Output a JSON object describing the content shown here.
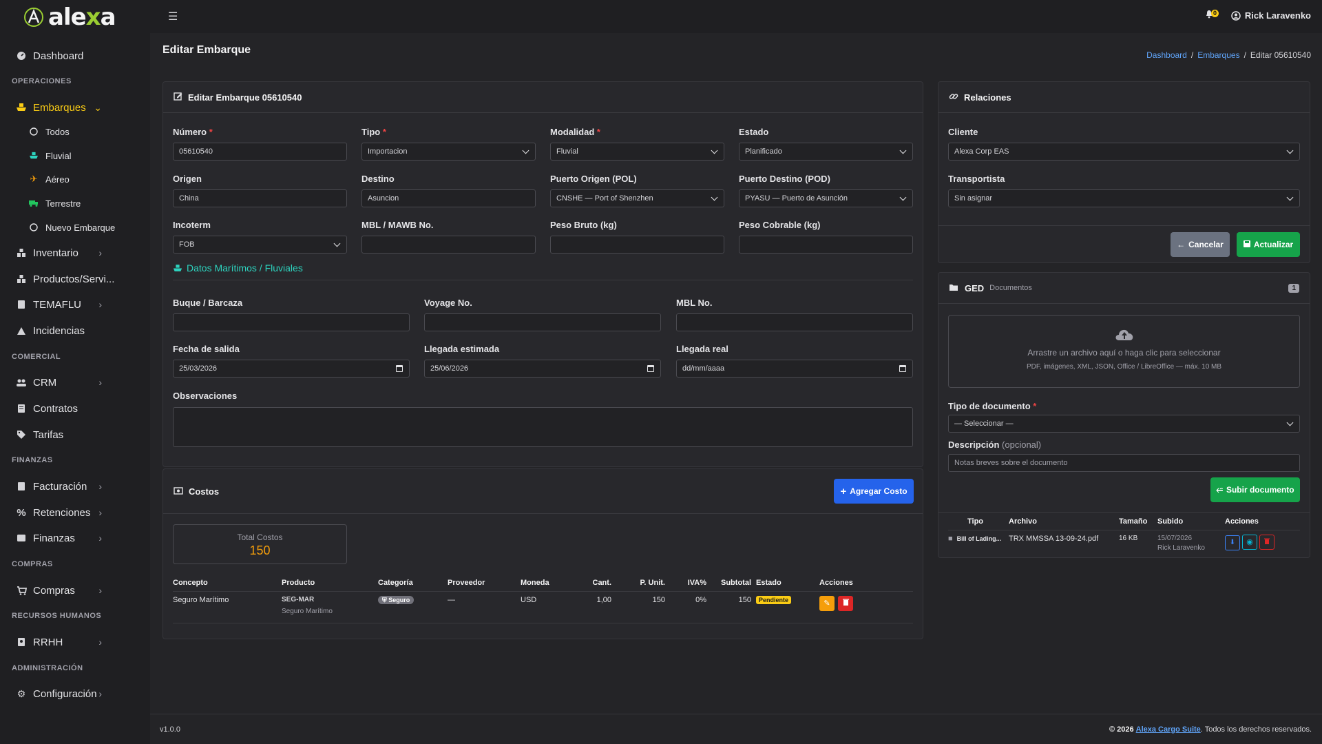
{
  "brand": {
    "name_pre": "ale",
    "name_x": "x",
    "name_post": "a"
  },
  "topbar": {
    "notif_count": "0",
    "user_name": "Rick Laravenko"
  },
  "sidebar": {
    "dashboard": "Dashboard",
    "h_operaciones": "OPERACIONES",
    "embarques": "Embarques",
    "sub": {
      "todos": "Todos",
      "fluvial": "Fluvial",
      "aereo": "Aéreo",
      "terrestre": "Terrestre",
      "nuevo": "Nuevo Embarque"
    },
    "inventario": "Inventario",
    "productos": "Productos/Servi...",
    "temaflu": "TEMAFLU",
    "incidencias": "Incidencias",
    "h_comercial": "COMERCIAL",
    "crm": "CRM",
    "contratos": "Contratos",
    "tarifas": "Tarifas",
    "h_finanzas": "FINANZAS",
    "facturacion": "Facturación",
    "retenciones": "Retenciones",
    "finanzas": "Finanzas",
    "h_compras": "COMPRAS",
    "compras": "Compras",
    "h_rrhh": "RECURSOS HUMANOS",
    "rrhh": "RRHH",
    "h_admin": "ADMINISTRACIÓN",
    "configuracion": "Configuración"
  },
  "page": {
    "title": "Editar Embarque",
    "breadcrumb": {
      "home": "Dashboard",
      "section": "Embarques",
      "sep": "/",
      "current": "Editar 05610540"
    }
  },
  "form": {
    "title": "Editar Embarque 05610540",
    "numero": {
      "label": "Número",
      "value": "05610540"
    },
    "tipo": {
      "label": "Tipo",
      "value": "Importacion"
    },
    "modalidad": {
      "label": "Modalidad",
      "value": "Fluvial"
    },
    "estado": {
      "label": "Estado",
      "value": "Planificado"
    },
    "origen": {
      "label": "Origen",
      "value": "China"
    },
    "destino": {
      "label": "Destino",
      "value": "Asuncion"
    },
    "pol": {
      "label": "Puerto Origen (POL)",
      "value": "CNSHE — Port of Shenzhen"
    },
    "pod": {
      "label": "Puerto Destino (POD)",
      "value": "PYASU — Puerto de Asunción"
    },
    "incoterm": {
      "label": "Incoterm",
      "value": "FOB"
    },
    "mbl_mawb": {
      "label": "MBL / MAWB No.",
      "value": ""
    },
    "peso_bruto": {
      "label": "Peso Bruto (kg)",
      "value": ""
    },
    "peso_cobrable": {
      "label": "Peso Cobrable (kg)",
      "value": ""
    },
    "maritimo_title": "Datos Marítimos / Fluviales",
    "buque": {
      "label": "Buque / Barcaza",
      "value": ""
    },
    "voyage": {
      "label": "Voyage No.",
      "value": ""
    },
    "mbl": {
      "label": "MBL No.",
      "value": ""
    },
    "fecha_salida": {
      "label": "Fecha de salida",
      "value": "25/03/2026"
    },
    "llegada_estimada": {
      "label": "Llegada estimada",
      "value": "25/06/2026"
    },
    "llegada_real": {
      "label": "Llegada real",
      "value": "dd/mm/aaaa"
    },
    "observaciones": {
      "label": "Observaciones",
      "value": ""
    }
  },
  "costos": {
    "title": "Costos",
    "add_button": "Agregar Costo",
    "total_label": "Total Costos",
    "total_value": "150",
    "columns": [
      "Concepto",
      "Producto",
      "Categoría",
      "Proveedor",
      "Moneda",
      "Cant.",
      "P. Unit.",
      "IVA%",
      "Subtotal",
      "Estado",
      "Acciones"
    ],
    "rows": [
      {
        "concepto": "Seguro Marítimo",
        "producto_code": "SEG-MAR",
        "producto_name": "Seguro Marítimo",
        "categoria": "Seguro",
        "proveedor": "—",
        "moneda": "USD",
        "cant": "1,00",
        "punit": "150",
        "iva": "0%",
        "subtotal": "150",
        "estado": "Pendiente"
      }
    ]
  },
  "relaciones": {
    "title": "Relaciones",
    "cliente": {
      "label": "Cliente",
      "value": "Alexa Corp EAS"
    },
    "transportista": {
      "label": "Transportista",
      "value": "Sin asignar"
    },
    "cancel": "Cancelar",
    "update": "Actualizar"
  },
  "ged": {
    "title": "GED",
    "subtitle": "Documentos",
    "count": "1",
    "drop_text": "Arrastre un archivo aquí o haga clic para seleccionar",
    "drop_hint": "PDF, imágenes, XML, JSON, Office / LibreOffice — máx. 10 MB",
    "tipo_label": "Tipo de documento",
    "tipo_value": "— Seleccionar —",
    "desc_label": "Descripción",
    "desc_optional": "(opcional)",
    "desc_placeholder": "Notas breves sobre el documento",
    "upload": "Subir documento",
    "columns": [
      "Tipo",
      "Archivo",
      "Tamaño",
      "Subido",
      "Acciones"
    ],
    "rows": [
      {
        "tipo": "Bill of Lading...",
        "archivo": "TRX MMSSA 13-09-24.pdf",
        "tamano": "16 KB",
        "fecha": "15/07/2026",
        "usuario": "Rick Laravenko"
      }
    ]
  },
  "footer": {
    "version": "v1.0.0",
    "copy_pre": "© 2026",
    "link": "Alexa Cargo Suite",
    "copy_post": ". Todos los derechos reservados."
  },
  "colors": {
    "accent_yellow": "#facc15",
    "teal": "#2dd4bf",
    "blue": "#2563eb",
    "green": "#16a34a",
    "total_orange": "#f59e0b"
  }
}
